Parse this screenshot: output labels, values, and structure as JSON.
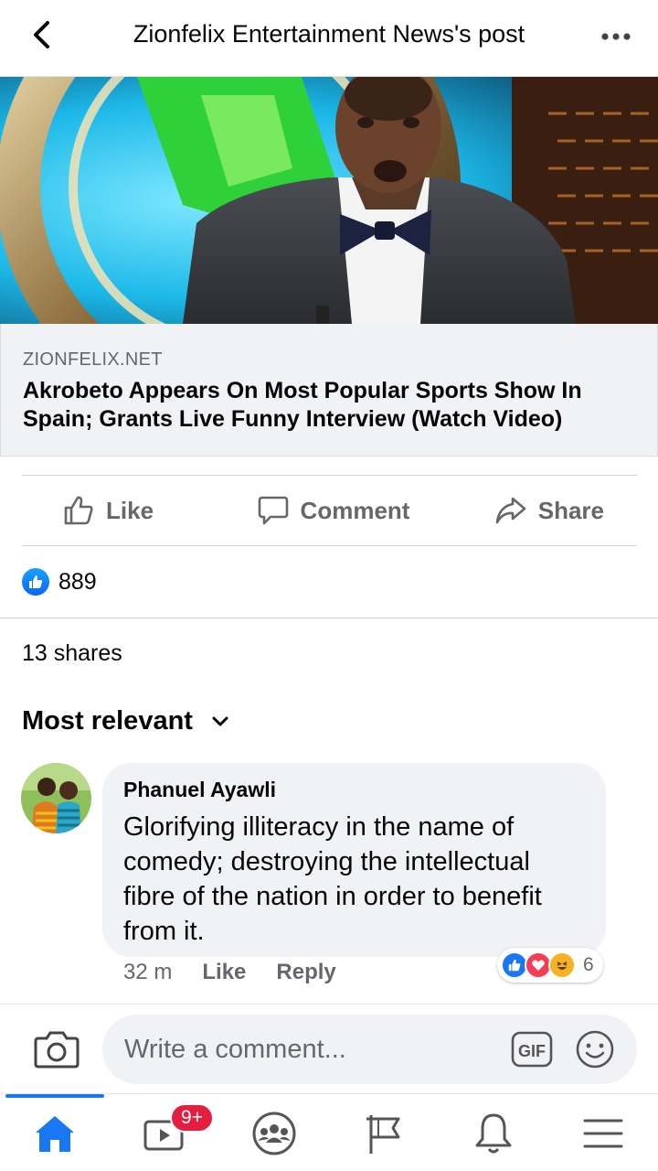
{
  "header": {
    "title": "Zionfelix Entertainment News's post",
    "back_icon": "chevron-left-icon",
    "more_icon": "more-dots-icon"
  },
  "link_preview": {
    "domain": "ZIONFELIX.NET",
    "title": "Akrobeto Appears On Most Popular Sports Show In Spain; Grants Live Funny Interview (Watch Video)"
  },
  "actions": {
    "like": "Like",
    "comment": "Comment",
    "share": "Share"
  },
  "reactions": {
    "count": "889"
  },
  "shares": "13 shares",
  "sort": {
    "label": "Most relevant"
  },
  "comment": {
    "author": "Phanuel Ayawli",
    "text": "Glorifying illiteracy in the name of comedy; destroying the intellectual fibre of the nation in order to benefit from it.",
    "time": "32 m",
    "like": "Like",
    "reply": "Reply",
    "reaction_count": "6",
    "reaction_icons": [
      "like-icon",
      "love-icon",
      "haha-icon"
    ]
  },
  "composer": {
    "placeholder": "Write a comment...",
    "gif_label": "GIF"
  },
  "nav": {
    "items": [
      "home-icon",
      "watch-icon",
      "groups-icon",
      "pages-flag-icon",
      "notifications-bell-icon",
      "menu-icon"
    ],
    "watch_badge": "9+"
  },
  "colors": {
    "accent": "#1877f2",
    "badge": "#e41e3f",
    "secondary_text": "#65676b",
    "bubble": "#f0f2f5"
  }
}
